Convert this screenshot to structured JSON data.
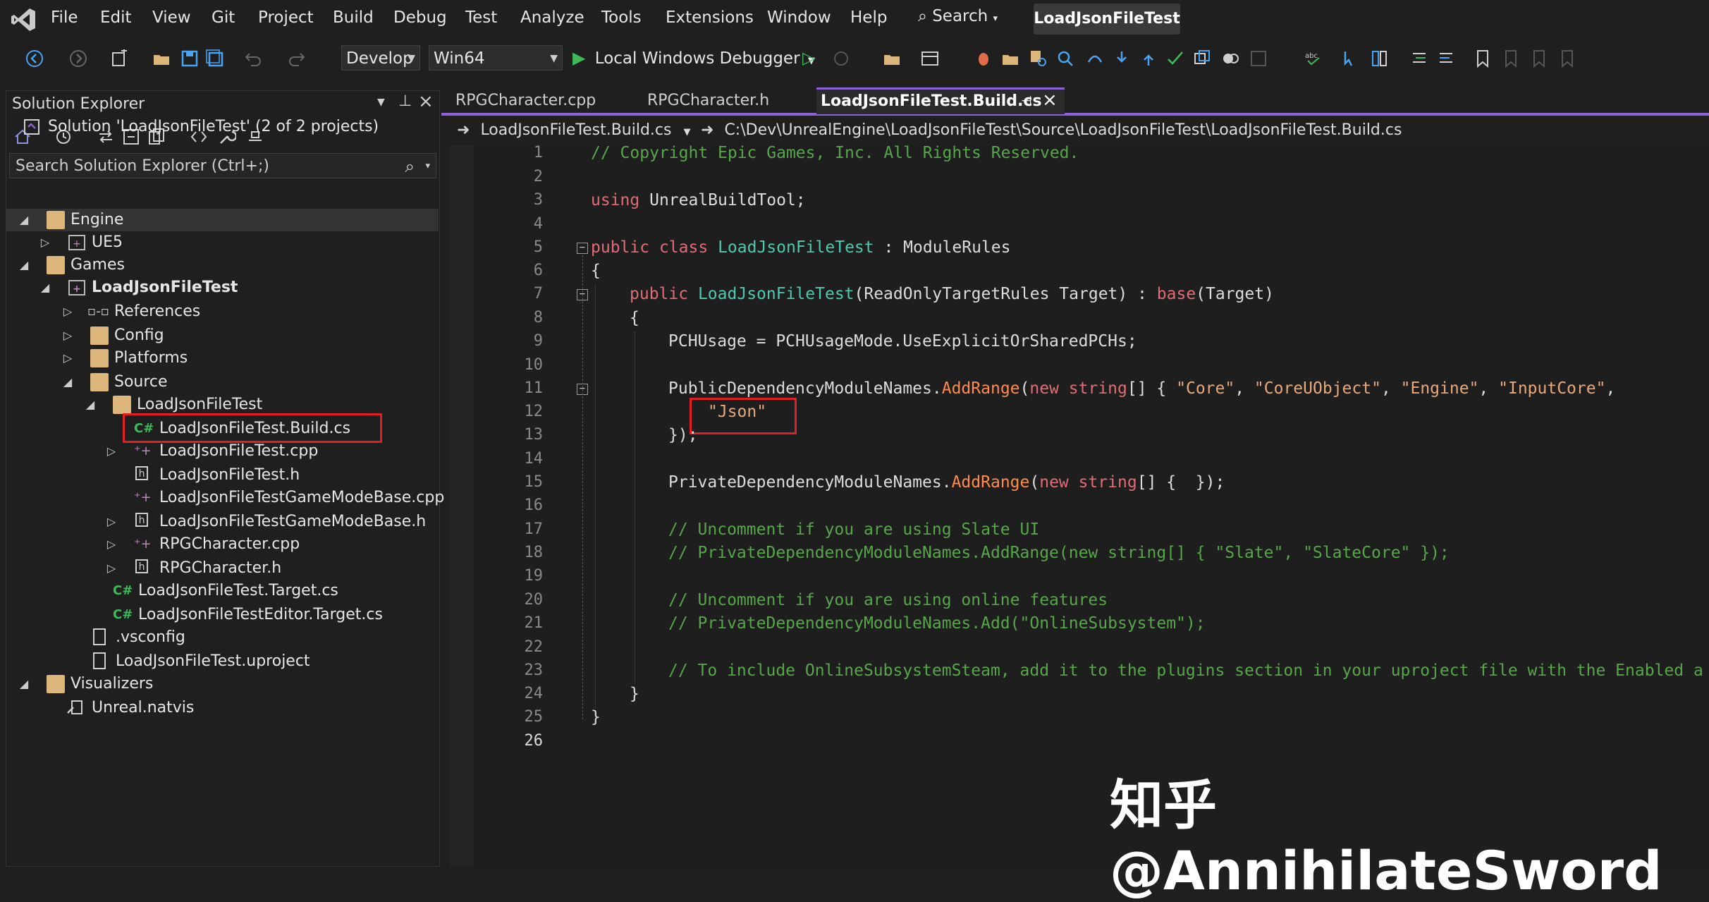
{
  "menu": {
    "items": [
      "File",
      "Edit",
      "View",
      "Git",
      "Project",
      "Build",
      "Debug",
      "Test",
      "Analyze",
      "Tools",
      "Extensions",
      "Window",
      "Help"
    ],
    "search_label": "Search",
    "title": "LoadJsonFileTest"
  },
  "toolbar": {
    "config_combo": "Develop",
    "platform_combo": "Win64",
    "debugger_label": "Local Windows Debugger"
  },
  "solution_explorer": {
    "title": "Solution Explorer",
    "search_placeholder": "Search Solution Explorer (Ctrl+;)",
    "tree": [
      {
        "label": "Solution 'LoadJsonFileTest' (2 of 2 projects)",
        "icon": "solution-icon"
      },
      {
        "label": "Engine",
        "icon": "folder-icon"
      },
      {
        "label": "UE5",
        "icon": "project-icon"
      },
      {
        "label": "Games",
        "icon": "folder-icon"
      },
      {
        "label": "LoadJsonFileTest",
        "icon": "project-icon"
      },
      {
        "label": "References",
        "icon": "references-icon"
      },
      {
        "label": "Config",
        "icon": "folder-icon"
      },
      {
        "label": "Platforms",
        "icon": "folder-icon"
      },
      {
        "label": "Source",
        "icon": "folder-icon"
      },
      {
        "label": "LoadJsonFileTest",
        "icon": "folder-icon"
      },
      {
        "label": "LoadJsonFileTest.Build.cs",
        "icon": "csharp-file-icon"
      },
      {
        "label": "LoadJsonFileTest.cpp",
        "icon": "cpp-file-icon"
      },
      {
        "label": "LoadJsonFileTest.h",
        "icon": "header-file-icon"
      },
      {
        "label": "LoadJsonFileTestGameModeBase.cpp",
        "icon": "cpp-file-icon"
      },
      {
        "label": "LoadJsonFileTestGameModeBase.h",
        "icon": "header-file-icon"
      },
      {
        "label": "RPGCharacter.cpp",
        "icon": "cpp-file-icon"
      },
      {
        "label": "RPGCharacter.h",
        "icon": "header-file-icon"
      },
      {
        "label": "LoadJsonFileTest.Target.cs",
        "icon": "csharp-file-icon"
      },
      {
        "label": "LoadJsonFileTestEditor.Target.cs",
        "icon": "csharp-file-icon"
      },
      {
        "label": ".vsconfig",
        "icon": "file-icon"
      },
      {
        "label": "LoadJsonFileTest.uproject",
        "icon": "file-icon"
      },
      {
        "label": "Visualizers",
        "icon": "folder-icon"
      },
      {
        "label": "Unreal.natvis",
        "icon": "natvis-file-icon"
      }
    ]
  },
  "editor": {
    "tabs": [
      "RPGCharacter.cpp",
      "RPGCharacter.h",
      "LoadJsonFileTest.Build.cs"
    ],
    "nav_file": "LoadJsonFileTest.Build.cs",
    "nav_path": "C:\\Dev\\UnrealEngine\\LoadJsonFileTest\\Source\\LoadJsonFileTest\\LoadJsonFileTest.Build.cs",
    "line_numbers": [
      "1",
      "2",
      "3",
      "4",
      "5",
      "6",
      "7",
      "8",
      "9",
      "10",
      "11",
      "12",
      "13",
      "14",
      "15",
      "16",
      "17",
      "18",
      "19",
      "20",
      "21",
      "22",
      "23",
      "24",
      "25",
      "26"
    ],
    "code": {
      "l1": "// Copyright Epic Games, Inc. All Rights Reserved.",
      "l3_kw": "using",
      "l3_rest": " UnrealBuildTool;",
      "l5_kw1": "public",
      "l5_kw2": "class",
      "l5_cls": "LoadJsonFileTest",
      "l5_rest": " : ModuleRules",
      "l6": "{",
      "l7_kw": "public",
      "l7_cls": "LoadJsonFileTest",
      "l7_mid": "(ReadOnlyTargetRules Target) : ",
      "l7_base": "base",
      "l7_end": "(Target)",
      "l8": "{",
      "l9": "PCHUsage = PCHUsageMode.UseExplicitOrSharedPCHs;",
      "l11_a": "PublicDependencyModuleNames.",
      "l11_meth": "AddRange",
      "l11_b": "(",
      "l11_new": "new",
      "l11_str": "string",
      "l11_c": "[] { ",
      "l11_s1": "\"Core\"",
      "l11_s2": "\"CoreUObject\"",
      "l11_s3": "\"Engine\"",
      "l11_s4": "\"InputCore\"",
      "l12": "\"Json\"",
      "l13": "});",
      "l15_a": "PrivateDependencyModuleNames.",
      "l15_meth": "AddRange",
      "l15_new": "new",
      "l15_str": "string",
      "l15_end": "[] {  });",
      "l17": "// Uncomment if you are using Slate UI",
      "l18": "// PrivateDependencyModuleNames.AddRange(new string[] { \"Slate\", \"SlateCore\" });",
      "l20": "// Uncomment if you are using online features",
      "l21": "// PrivateDependencyModuleNames.Add(\"OnlineSubsystem\");",
      "l23": "// To include OnlineSubsystemSteam, add it to the plugins section in your uproject file with the Enabled a",
      "l24": "}",
      "l25": "}"
    }
  },
  "watermark": "知乎 @AnnihilateSword",
  "colors": {
    "background": "#1f1f1f",
    "accent": "#8f5fdc",
    "highlight_box": "#e01e24",
    "comment": "#57a64a",
    "keyword": "#e06c75",
    "class": "#4ec9b0",
    "string": "#e8a87c"
  }
}
